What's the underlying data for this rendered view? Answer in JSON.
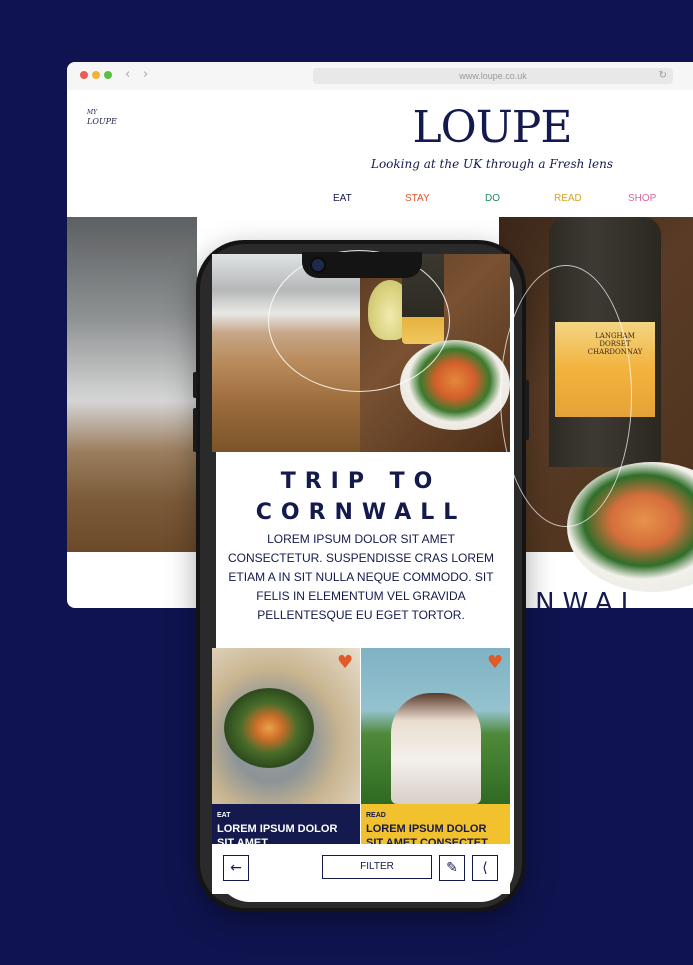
{
  "browser": {
    "url": "www.loupe.co.uk",
    "back_icon": "chevron-left-icon",
    "forward_icon": "chevron-right-icon",
    "reload_icon": "reload-icon"
  },
  "site": {
    "mini_logo_top": "MY",
    "mini_logo_bottom": "LOUPE",
    "brand": "LOUPE",
    "tagline": "Looking at the UK through a Fresh lens",
    "nav": [
      {
        "label": "EAT",
        "color": "#141a4d"
      },
      {
        "label": "STAY",
        "color": "#e0532a"
      },
      {
        "label": "DO",
        "color": "#1f8a5a"
      },
      {
        "label": "READ",
        "color": "#d7a12a"
      },
      {
        "label": "SHOP",
        "color": "#d56a9c"
      }
    ],
    "hero_title_fragment": "RNWAL",
    "wine_label": "LANGHAM DORSET CHARDONNAY"
  },
  "phone": {
    "article": {
      "title_line1": "TRIP TO",
      "title_line2": "CORNWALL",
      "body": "LOREM IPSUM DOLOR SIT AMET CONSECTETUR. SUSPENDISSE CRAS LOREM ETIAM A IN SIT NULLA NEQUE COMMODO. SIT FELIS IN ELEMENTUM VEL GRAVIDA PELLENTESQUE EU EGET TORTOR."
    },
    "cards": [
      {
        "category": "EAT",
        "headline": "LOREM IPSUM DOLOR SIT AMET"
      },
      {
        "category": "READ",
        "headline": "LOREM IPSUM DOLOR SIT AMET CONSECTET"
      }
    ],
    "toolbar": {
      "back_icon": "arrow-left-icon",
      "filter_label": "FILTER",
      "edit_icon": "pencil-icon",
      "share_icon": "share-icon"
    }
  }
}
